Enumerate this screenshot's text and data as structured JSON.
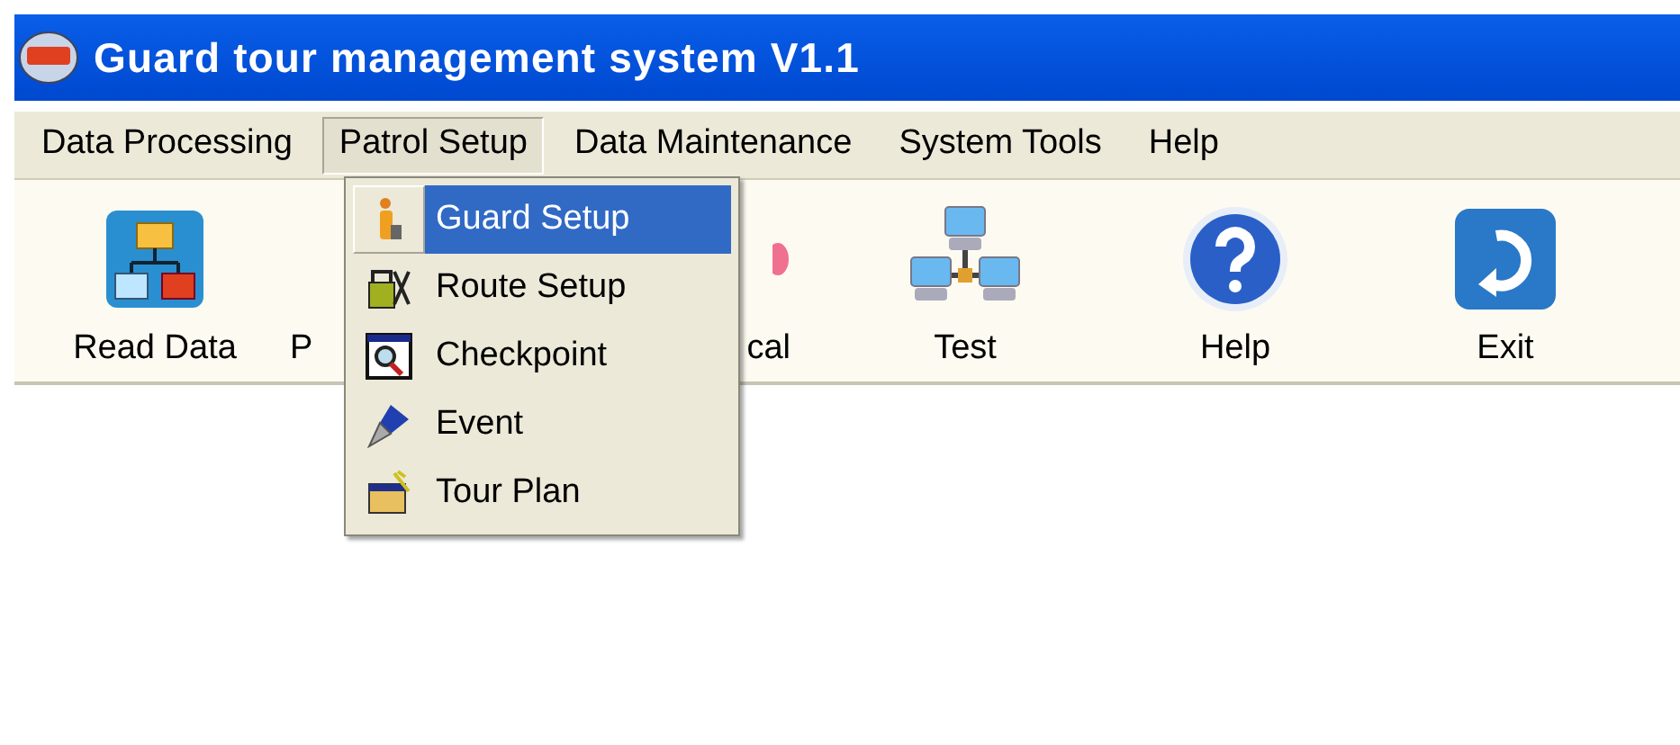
{
  "window": {
    "title": "Guard tour management system V1.1"
  },
  "menu_bar": [
    {
      "label": "Data Processing",
      "selected": false
    },
    {
      "label": "Patrol Setup",
      "selected": true
    },
    {
      "label": "Data Maintenance",
      "selected": false
    },
    {
      "label": "System Tools",
      "selected": false
    },
    {
      "label": "Help",
      "selected": false
    }
  ],
  "toolbar": [
    {
      "label": "Read Data",
      "kind": "chart"
    },
    {
      "label": "P",
      "kind": "covered_right"
    },
    {
      "label": "cal",
      "kind": "covered_left"
    },
    {
      "label": "Test",
      "kind": "network"
    },
    {
      "label": "Help",
      "kind": "help"
    },
    {
      "label": "Exit",
      "kind": "exit"
    }
  ],
  "dropdown": [
    {
      "label": "Guard Setup",
      "kind": "guard",
      "selected": true
    },
    {
      "label": "Route Setup",
      "kind": "tools",
      "selected": false
    },
    {
      "label": "Checkpoint",
      "kind": "checkpoint",
      "selected": false
    },
    {
      "label": "Event",
      "kind": "pen",
      "selected": false
    },
    {
      "label": "Tour Plan",
      "kind": "plan",
      "selected": false
    }
  ]
}
